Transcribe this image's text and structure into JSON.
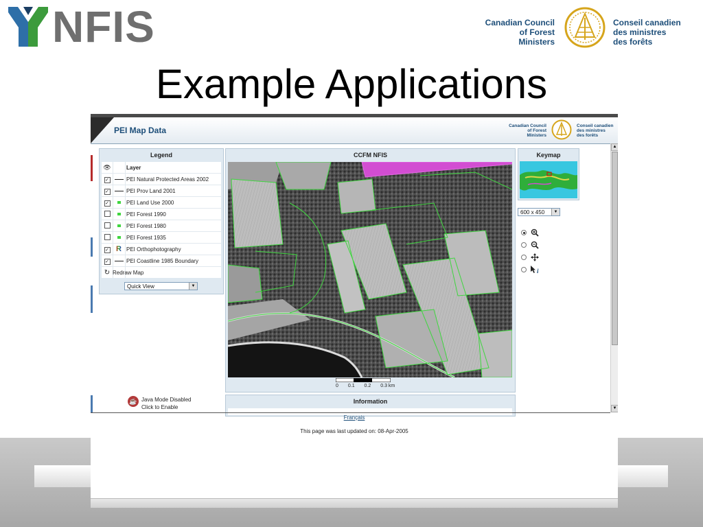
{
  "slide": {
    "logo_text": "NFIS",
    "ccfm_en": [
      "Canadian Council",
      "of Forest",
      "Ministers"
    ],
    "ccfm_fr": [
      "Conseil canadien",
      "des ministres",
      "des forêts"
    ],
    "title": "Example Applications"
  },
  "app": {
    "title": "PEI Map Data",
    "header_en": [
      "Canadian Council",
      "of Forest",
      "Ministers"
    ],
    "header_fr": [
      "Conseil canadien",
      "des ministres",
      "des forêts"
    ],
    "legend": {
      "title": "Legend",
      "column_header": "Layer",
      "layers": [
        {
          "name": "PEI Natural Protected Areas 2002",
          "checked": true,
          "symbol": "line"
        },
        {
          "name": "PEI Prov Land 2001",
          "checked": true,
          "symbol": "line"
        },
        {
          "name": "PEI Land Use 2000",
          "checked": true,
          "symbol": "green"
        },
        {
          "name": "PEI Forest 1990",
          "checked": false,
          "symbol": "green"
        },
        {
          "name": "PEI Forest 1980",
          "checked": false,
          "symbol": "green"
        },
        {
          "name": "PEI Forest 1935",
          "checked": false,
          "symbol": "green"
        },
        {
          "name": "PEI Orthophotography",
          "checked": true,
          "symbol": "raster"
        },
        {
          "name": "PEI Coastline 1985 Boundary",
          "checked": true,
          "symbol": "line"
        }
      ],
      "redraw_label": "Redraw Map",
      "quick_view": "Quick View"
    },
    "map_panel": {
      "title": "CCFM NFIS",
      "scale_labels": [
        "0",
        "0.1",
        "0.2",
        "0.3 km"
      ]
    },
    "keymap": {
      "title": "Keymap",
      "size_select": "600 x 450",
      "tools": [
        "zoom-in",
        "zoom-out",
        "pan",
        "identify"
      ],
      "selected_tool": "zoom-in"
    },
    "information": {
      "title": "Information"
    },
    "java": {
      "line1": "Java Mode Disabled",
      "line2": "Click to Enable"
    },
    "footer": {
      "language_link": "Français",
      "updated": "This page was last updated on: 08-Apr-2005"
    },
    "colors": {
      "brand_blue": "#1d4e79",
      "panel_bg": "#dfe9f1",
      "parcel_green": "#3fd63f",
      "protected_magenta": "#d24dd2"
    }
  }
}
